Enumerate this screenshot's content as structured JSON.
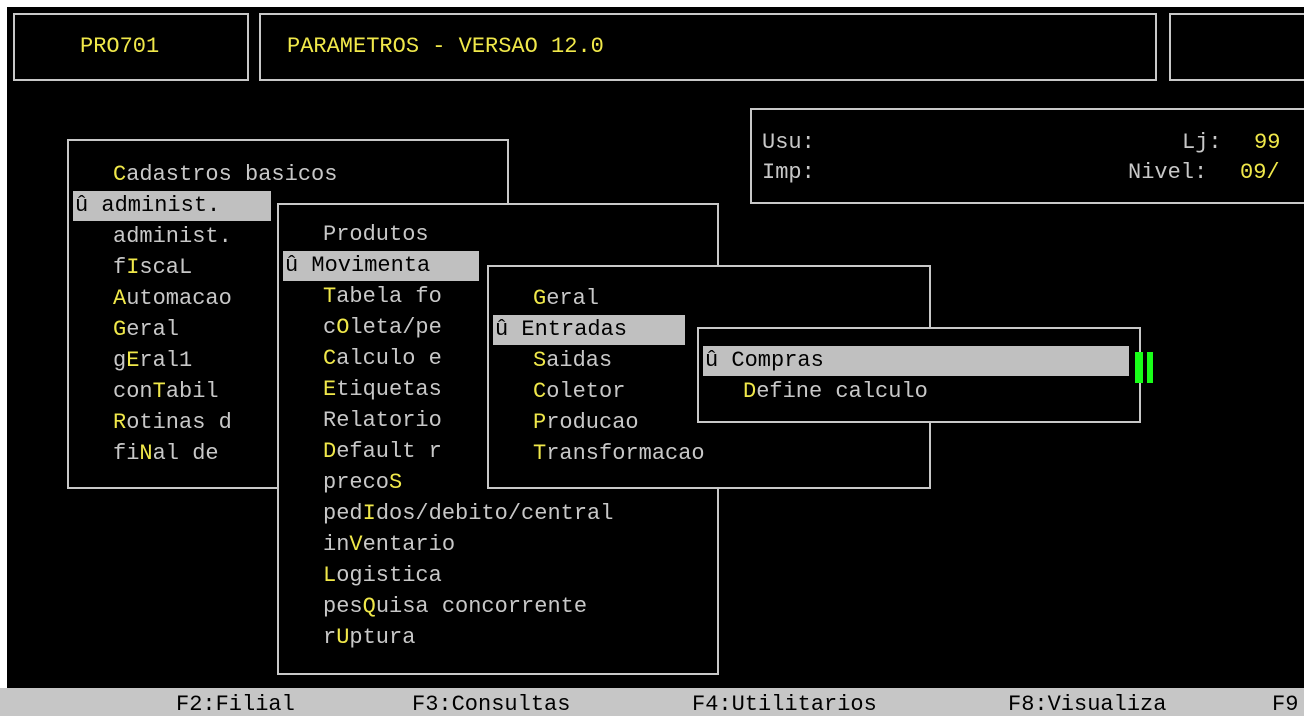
{
  "header": {
    "program_id": "PRO701",
    "title": "PARAMETROS - VERSAO 12.0"
  },
  "info": {
    "usu_label": "Usu:",
    "imp_label": "Imp:",
    "lj_label": "Lj:",
    "lj_value": "99",
    "nivel_label": "Nivel:",
    "nivel_value": "09/"
  },
  "menu1": {
    "items": [
      {
        "prefix": "",
        "hot": "C",
        "rest": "adastros basicos"
      },
      {
        "prefix": "û ",
        "hot": "",
        "rest": "administ.",
        "selected": true
      },
      {
        "prefix": "",
        "hot": "",
        "rest": "administ."
      },
      {
        "prefix": "f",
        "hot": "I",
        "rest": "scaL"
      },
      {
        "prefix": "",
        "hot": "A",
        "rest": "utomacao"
      },
      {
        "prefix": "",
        "hot": "G",
        "rest": "eral"
      },
      {
        "prefix": "g",
        "hot": "E",
        "rest": "ral1"
      },
      {
        "prefix": "con",
        "hot": "T",
        "rest": "abil"
      },
      {
        "prefix": "",
        "hot": "R",
        "rest": "otinas d"
      },
      {
        "prefix": "fi",
        "hot": "N",
        "rest": "al de"
      }
    ]
  },
  "menu2": {
    "items": [
      {
        "prefix": "",
        "hot": "",
        "rest": "Produtos"
      },
      {
        "prefix": "û ",
        "hot": "",
        "rest": "Movimenta",
        "selected": true
      },
      {
        "prefix": "",
        "hot": "T",
        "rest": "abela fo"
      },
      {
        "prefix": "c",
        "hot": "O",
        "rest": "leta/pe"
      },
      {
        "prefix": "",
        "hot": "C",
        "rest": "alculo e"
      },
      {
        "prefix": "",
        "hot": "E",
        "rest": "tiquetas"
      },
      {
        "prefix": "",
        "hot": "",
        "rest": "Relatorio"
      },
      {
        "prefix": "",
        "hot": "D",
        "rest": "efault r"
      },
      {
        "prefix": "preco",
        "hot": "S",
        "rest": ""
      },
      {
        "prefix": "ped",
        "hot": "I",
        "rest": "dos/debito/central"
      },
      {
        "prefix": "in",
        "hot": "V",
        "rest": "entario"
      },
      {
        "prefix": "",
        "hot": "L",
        "rest": "ogistica"
      },
      {
        "prefix": "pes",
        "hot": "Q",
        "rest": "uisa concorrente"
      },
      {
        "prefix": "r",
        "hot": "U",
        "rest": "ptura"
      }
    ]
  },
  "menu3": {
    "items": [
      {
        "prefix": "",
        "hot": "G",
        "rest": "eral"
      },
      {
        "prefix": "û ",
        "hot": "",
        "rest": "Entradas",
        "selected": true
      },
      {
        "prefix": "",
        "hot": "S",
        "rest": "aidas"
      },
      {
        "prefix": "",
        "hot": "C",
        "rest": "oletor"
      },
      {
        "prefix": "",
        "hot": "P",
        "rest": "roducao"
      },
      {
        "prefix": "",
        "hot": "T",
        "rest": "ransformacao"
      }
    ]
  },
  "menu4": {
    "items": [
      {
        "prefix": "û ",
        "hot": "",
        "rest": "Compras",
        "selected": true
      },
      {
        "prefix": "",
        "hot": "D",
        "rest": "efine calculo"
      }
    ]
  },
  "footer": {
    "keys": [
      "F2:Filial",
      "F3:Consultas",
      "F4:Utilitarios",
      "F8:Visualiza",
      "F9"
    ]
  },
  "colors": {
    "background": "#000000",
    "text": "#c8c8c8",
    "hotkey": "#f0e84a",
    "highlight": "#c0c0c0",
    "cursor": "#19ff19"
  }
}
